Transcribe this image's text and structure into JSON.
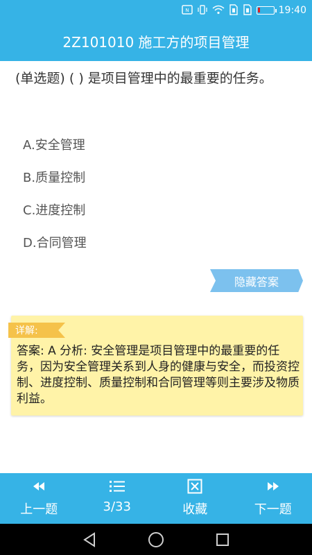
{
  "status_bar": {
    "icons": [
      "nfc-icon",
      "vibrate-icon",
      "wifi-icon",
      "sim1-icon",
      "sim2-icon",
      "battery-icon"
    ],
    "time": "19:40",
    "battery_color": "#e02020"
  },
  "header": {
    "title": "2Z101010 施工方的项目管理"
  },
  "question": {
    "text": "(单选题) (          ) 是项目管理中的最重要的任务。"
  },
  "options": [
    {
      "label": "A.安全管理"
    },
    {
      "label": "B.质量控制"
    },
    {
      "label": "C.进度控制"
    },
    {
      "label": "D.合同管理"
    }
  ],
  "answer_toggle": {
    "label": "隐藏答案"
  },
  "explanation": {
    "tag": "详解:",
    "text": "答案: A 分析: 安全管理是项目管理中的最重要的任务，因为安全管理关系到人身的健康与安全，而投资控制、进度控制、质量控制和合同管理等则主要涉及物质利益。"
  },
  "bottom_nav": {
    "prev_label": "上一题",
    "progress": "3/33",
    "favorite_label": "收藏",
    "next_label": "下一题"
  },
  "colors": {
    "primary": "#36b3e6",
    "answer_button": "#7cc1ee",
    "explanation_bg": "#fff3a8",
    "tag_bg": "#f5c24a"
  }
}
